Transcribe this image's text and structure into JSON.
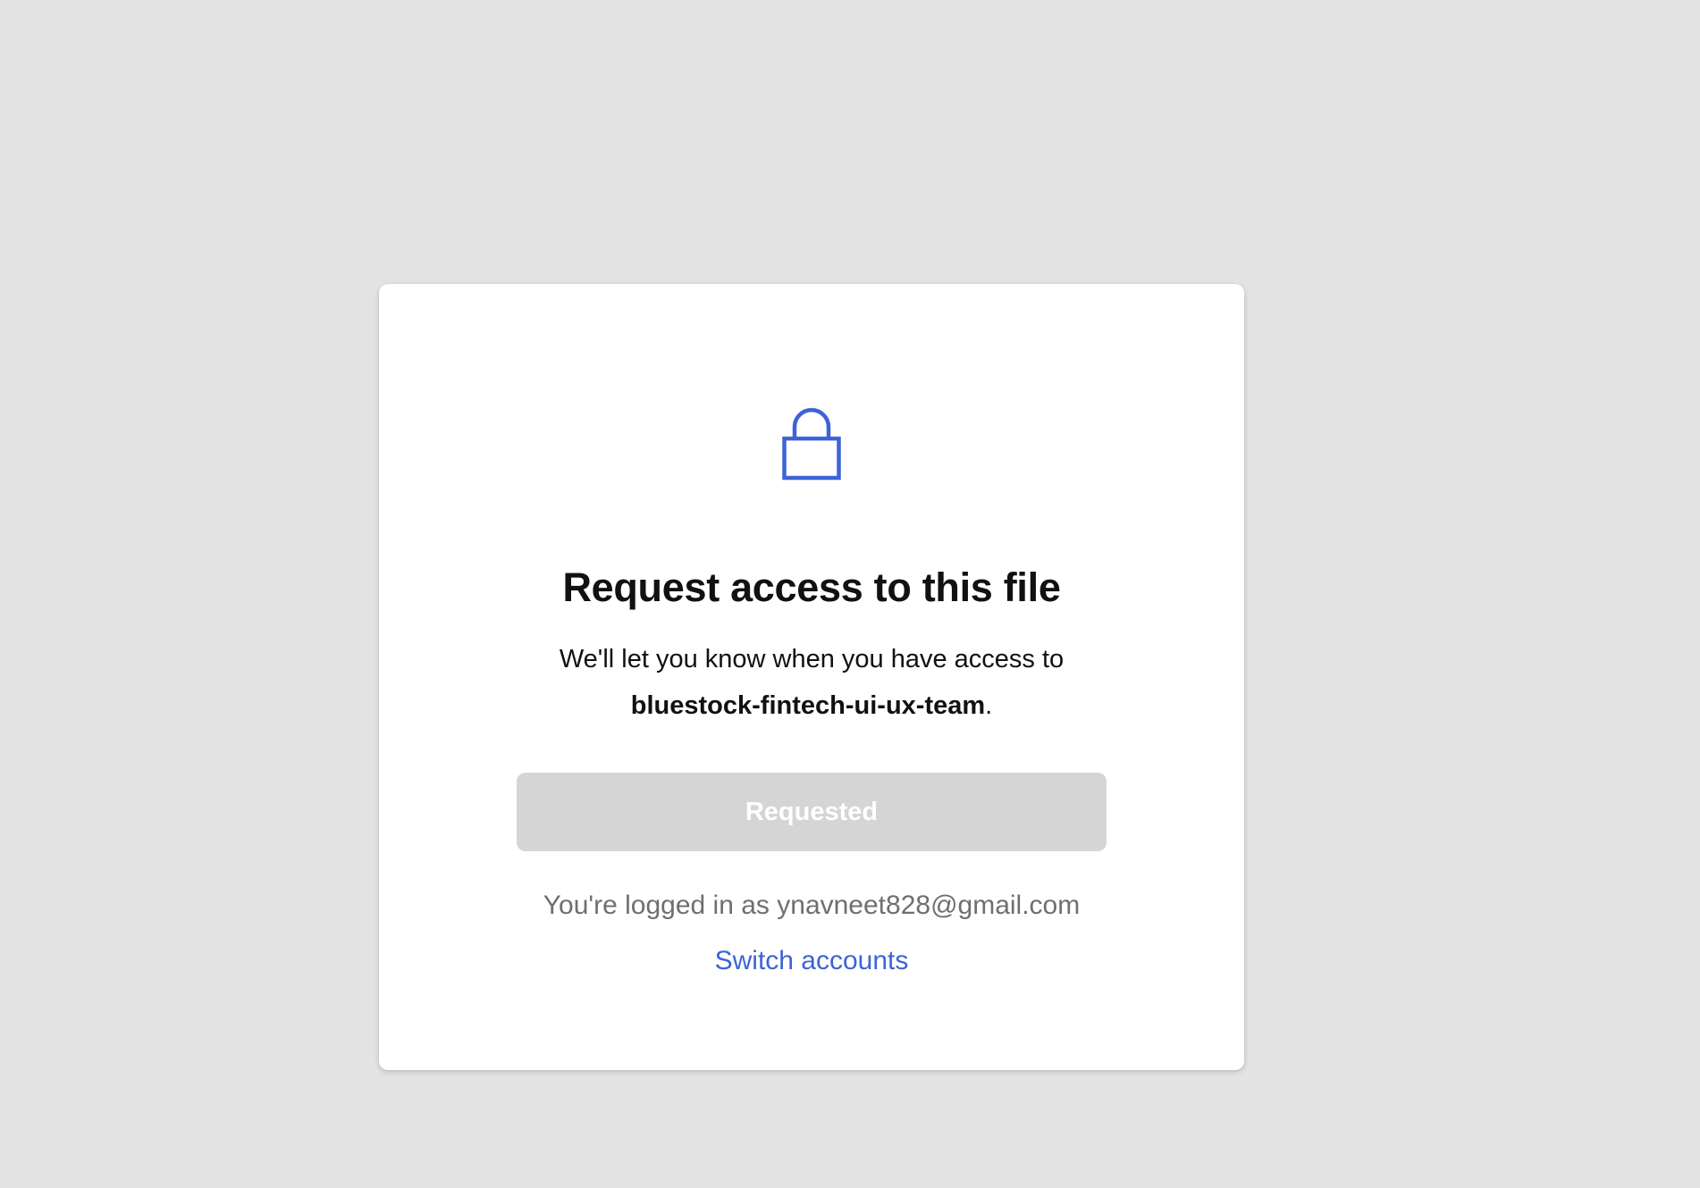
{
  "dialog": {
    "icon": "lock-icon",
    "title": "Request access to this file",
    "description_prefix": "We'll let you know when you have access to",
    "file_name": "bluestock-fintech-ui-ux-team",
    "description_suffix": ".",
    "button_label": "Requested",
    "logged_in_text": "You're logged in as ynavneet828@gmail.com",
    "switch_accounts_label": "Switch accounts"
  },
  "colors": {
    "background": "#e3e3e3",
    "card": "#ffffff",
    "accent": "#3d63d6",
    "button_disabled": "#d5d5d5"
  }
}
